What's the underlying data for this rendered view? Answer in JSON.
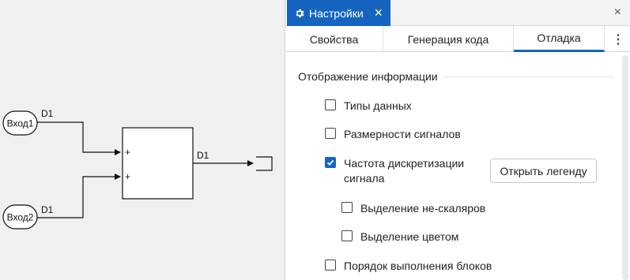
{
  "diagram": {
    "inputs": [
      {
        "label": "Вход1",
        "signal": "D1"
      },
      {
        "label": "Вход2",
        "signal": "D1"
      }
    ],
    "sum_block": {
      "port_signs": [
        "+",
        "+"
      ]
    },
    "output_signal": "D1"
  },
  "panel": {
    "title": "Настройки",
    "close_glyph": "×",
    "tabs": [
      {
        "label": "Свойства",
        "active": false
      },
      {
        "label": "Генерация кода",
        "active": false
      },
      {
        "label": "Отладка",
        "active": true
      }
    ],
    "more_glyph": "⋮",
    "section": {
      "title": "Отображение информации",
      "options": [
        {
          "label": "Типы данных",
          "checked": false
        },
        {
          "label": "Размерности сигналов",
          "checked": false
        },
        {
          "label": "Частота дискретизации сигнала",
          "checked": true
        },
        {
          "label": "Выделение не-скаляров",
          "checked": false
        },
        {
          "label": "Выделение цветом",
          "checked": false
        },
        {
          "label": "Порядок выполнения блоков",
          "checked": false
        }
      ],
      "legend_button": "Открыть легенду"
    }
  },
  "colors": {
    "accent": "#1565c0",
    "canvas": "#f0f0f0"
  },
  "icons": {
    "title": "gear-icon",
    "checkbox_checked": "check-icon"
  }
}
